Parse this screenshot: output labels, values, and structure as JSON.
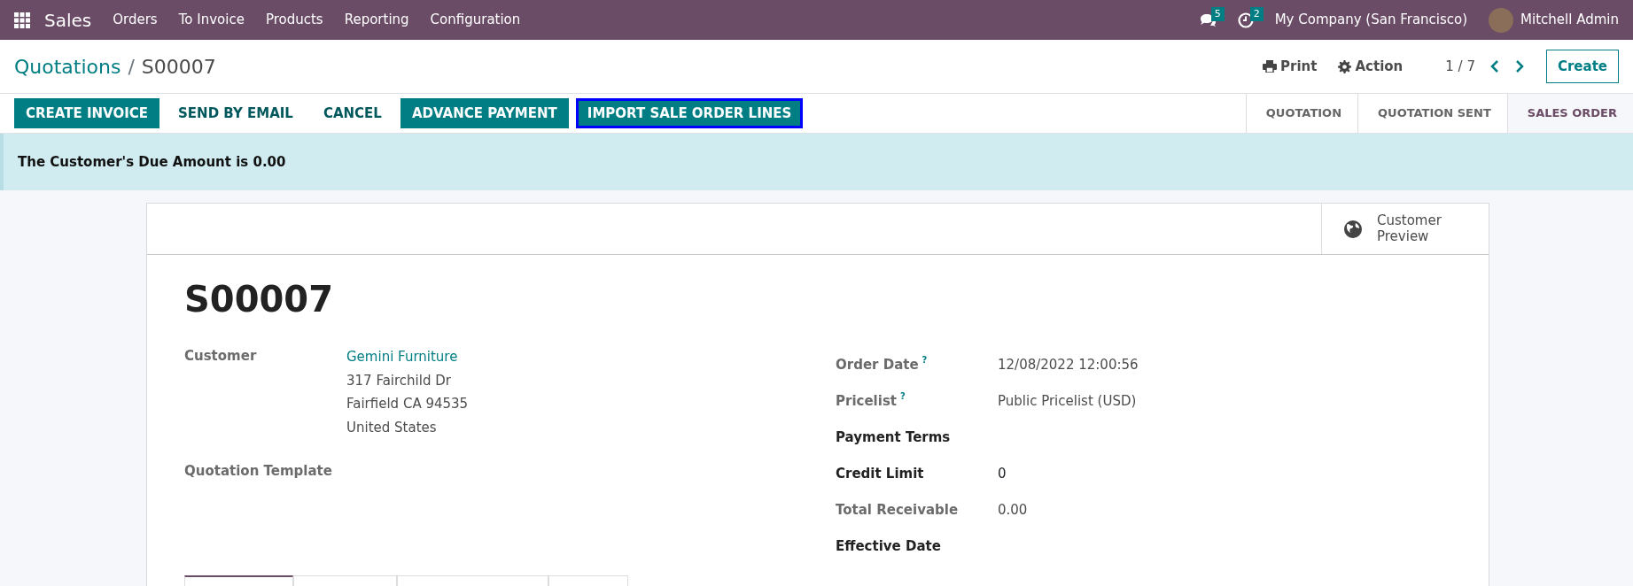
{
  "navbar": {
    "app": "Sales",
    "menu": [
      "Orders",
      "To Invoice",
      "Products",
      "Reporting",
      "Configuration"
    ],
    "messages_count": "5",
    "activities_count": "2",
    "company": "My Company (San Francisco)",
    "user": "Mitchell Admin"
  },
  "breadcrumb": [
    {
      "label": "Quotations",
      "link": true
    },
    {
      "label": "S00007",
      "link": false
    }
  ],
  "breadcrumb_separator": "/",
  "control_panel": {
    "print": "Print",
    "action": "Action",
    "pager": "1 / 7",
    "create": "Create"
  },
  "action_buttons": [
    {
      "label": "CREATE INVOICE",
      "kind": "primary",
      "focused": false
    },
    {
      "label": "SEND BY EMAIL",
      "kind": "link",
      "focused": false
    },
    {
      "label": "CANCEL",
      "kind": "link",
      "focused": false
    },
    {
      "label": "ADVANCE PAYMENT",
      "kind": "primary",
      "focused": false
    },
    {
      "label": "IMPORT SALE ORDER LINES",
      "kind": "primary",
      "focused": true
    }
  ],
  "status_steps": [
    {
      "label": "QUOTATION",
      "selected": false
    },
    {
      "label": "QUOTATION SENT",
      "selected": false
    },
    {
      "label": "SALES ORDER",
      "selected": true
    }
  ],
  "alert": "The Customer's Due Amount is 0.00",
  "smart_button": {
    "label": "Customer Preview"
  },
  "title": "S00007",
  "left_fields": [
    {
      "label": "Customer",
      "link": "Gemini Furniture",
      "lines": [
        "317 Fairchild Dr",
        "Fairfield CA 94535",
        "United States"
      ]
    },
    {
      "label": "Quotation Template"
    }
  ],
  "right_fields": [
    {
      "label": "Order Date",
      "help": "?",
      "bold": false,
      "value": "12/08/2022 12:00:56"
    },
    {
      "label": "Pricelist",
      "help": "?",
      "bold": false,
      "value": "Public Pricelist (USD)"
    },
    {
      "label": "Payment Terms",
      "bold": true
    },
    {
      "label": "Credit Limit",
      "bold": true,
      "value": "0"
    },
    {
      "label": "Total Receivable",
      "bold": false,
      "value": "0.00"
    },
    {
      "label": "Effective Date",
      "bold": true
    }
  ],
  "notebook_tabs": [
    {
      "selected": true
    },
    {
      "selected": false
    },
    {
      "selected": false
    },
    {
      "selected": false
    }
  ]
}
